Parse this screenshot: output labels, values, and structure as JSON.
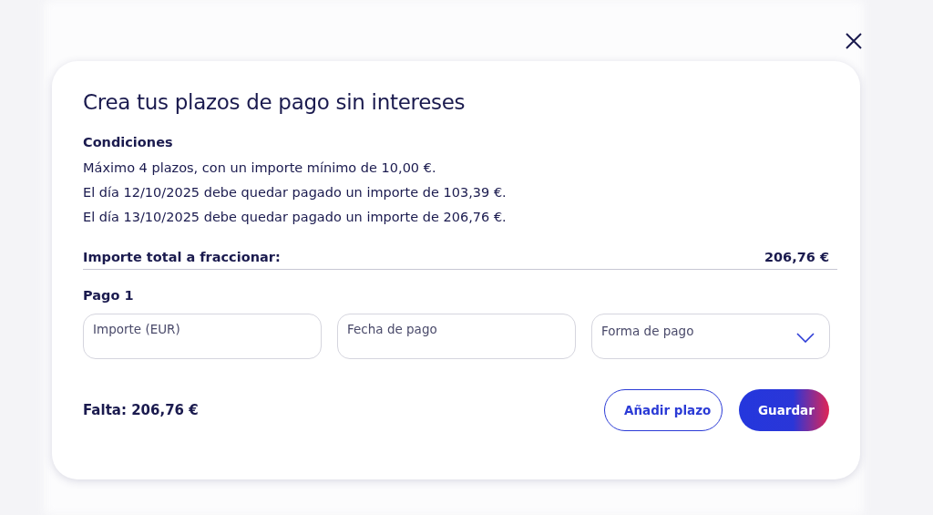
{
  "dialog": {
    "title": "Crea tus plazos de pago sin intereses",
    "conditions": {
      "heading": "Condiciones",
      "lines": [
        "Máximo 4 plazos, con un importe mínimo de 10,00 €.",
        "El día 12/10/2025 debe quedar pagado un importe de 103,39 €.",
        "El día 13/10/2025 debe quedar pagado un importe de 206,76 €."
      ]
    },
    "total": {
      "label": "Importe total a fraccionar:",
      "value": "206,76 €"
    },
    "payments": [
      {
        "heading": "Pago 1",
        "fields": [
          {
            "kind": "text",
            "placeholder": "Importe (EUR)"
          },
          {
            "kind": "text",
            "placeholder": "Fecha de pago"
          },
          {
            "kind": "select",
            "placeholder": "Forma de pago"
          }
        ]
      }
    ],
    "remaining": "Falta: 206,76 €",
    "buttons": [
      {
        "kind": "secondary",
        "label": "Añadir plazo"
      },
      {
        "kind": "primary",
        "label": "Guardar"
      }
    ]
  }
}
